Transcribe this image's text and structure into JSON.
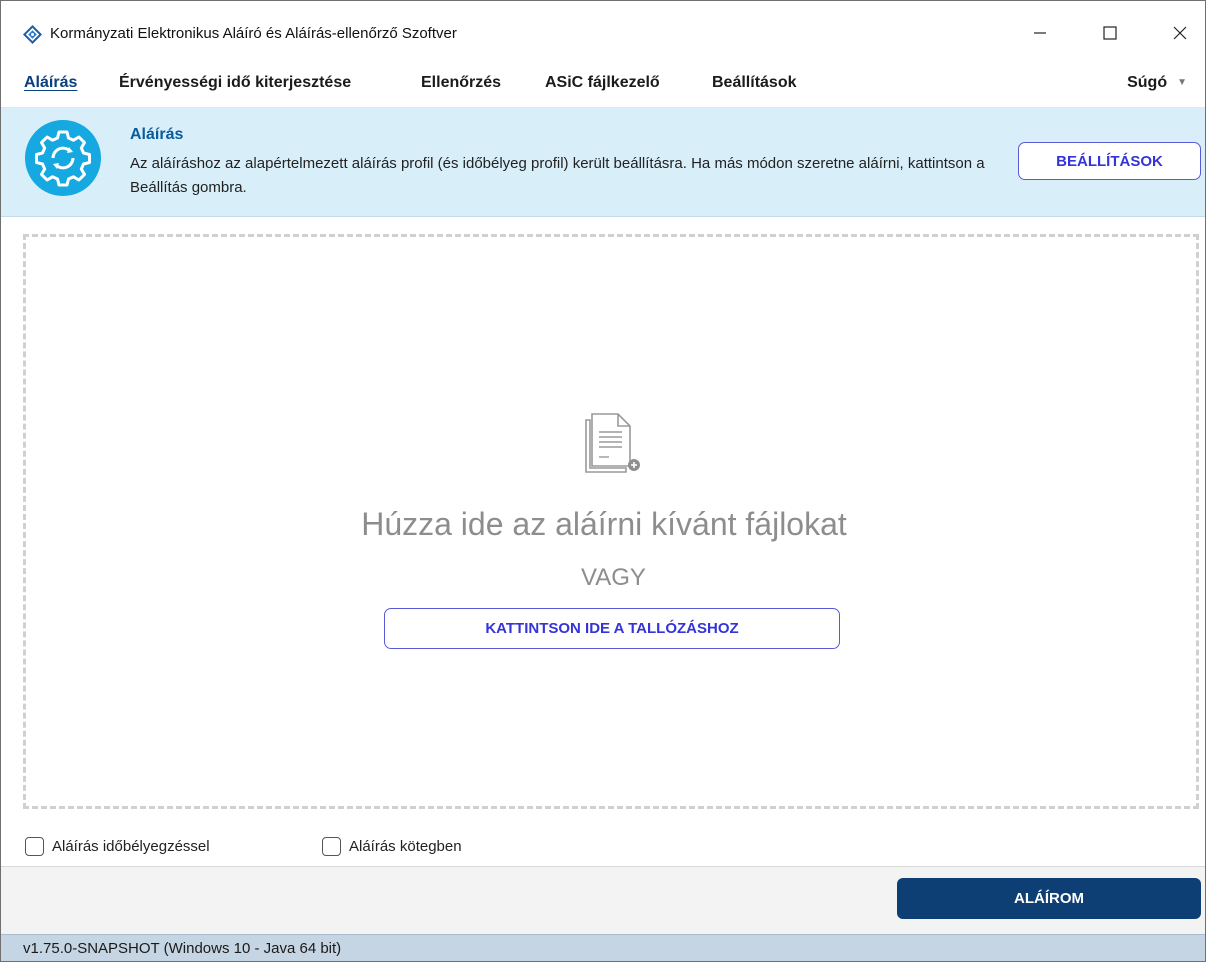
{
  "window": {
    "title": "Kormányzati Elektronikus Aláíró és Aláírás-ellenőrző Szoftver",
    "controls": {
      "minimize_icon": "minimize-icon",
      "maximize_icon": "maximize-icon",
      "close_icon": "close-icon"
    }
  },
  "menu": {
    "items": [
      {
        "label": "Aláírás",
        "active": true
      },
      {
        "label": "Érvényességi idő kiterjesztése",
        "active": false
      },
      {
        "label": "Ellenőrzés",
        "active": false
      },
      {
        "label": "ASiC fájlkezelő",
        "active": false
      },
      {
        "label": "Beállítások",
        "active": false
      }
    ],
    "help_label": "Súgó"
  },
  "banner": {
    "icon": "gear-sync-icon",
    "title": "Aláírás",
    "text": "Az aláíráshoz az alapértelmezett aláírás profil (és időbélyeg profil) került beállításra. Ha más módon szeretne aláírni, kattintson a Beállítás gombra.",
    "button_label": "BEÁLLÍTÁSOK",
    "background_color": "#d8effa"
  },
  "dropzone": {
    "icon": "add-document-icon",
    "prompt": "Húzza ide az aláírni kívánt fájlokat",
    "or_text": "VAGY",
    "browse_label": "KATTINTSON IDE A TALLÓZÁSHOZ"
  },
  "options": [
    {
      "label": "Aláírás időbélyegzéssel",
      "checked": false
    },
    {
      "label": "Aláírás kötegben",
      "checked": false
    }
  ],
  "actions": {
    "sign_label": "ALÁÍROM",
    "sign_color": "#0d3f75"
  },
  "status": {
    "version": "v1.75.0-SNAPSHOT (Windows 10 - Java 64 bit)"
  }
}
